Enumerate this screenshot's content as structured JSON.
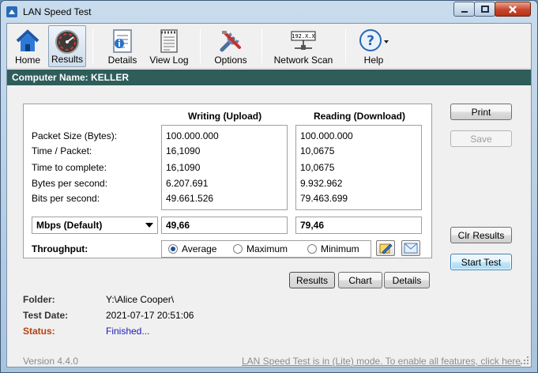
{
  "window": {
    "title": "LAN Speed Test"
  },
  "toolbar": {
    "items": [
      {
        "label": "Home",
        "icon": "home-icon"
      },
      {
        "label": "Results",
        "icon": "gauge-icon",
        "active": true
      },
      {
        "label": "Details",
        "icon": "details-icon"
      },
      {
        "label": "View Log",
        "icon": "log-icon"
      },
      {
        "label": "Options",
        "icon": "tools-icon"
      },
      {
        "label": "Network Scan",
        "icon": "network-icon",
        "badge": "192.X.X"
      },
      {
        "label": "Help",
        "icon": "help-icon"
      }
    ]
  },
  "header": {
    "computer_name": "Computer Name: KELLER"
  },
  "results": {
    "col_upload": "Writing (Upload)",
    "col_download": "Reading (Download)",
    "rows": [
      {
        "label": "Packet Size (Bytes):",
        "upload": "100.000.000",
        "download": "100.000.000"
      },
      {
        "label": "Time / Packet:",
        "upload": "16,1090",
        "download": "10,0675"
      },
      {
        "label": "Time to complete:",
        "upload": "16,1090",
        "download": "10,0675"
      },
      {
        "label": "Bytes per second:",
        "upload": "6.207.691",
        "download": "9.932.962"
      },
      {
        "label": "Bits per second:",
        "upload": "49.661.526",
        "download": "79.463.699"
      }
    ],
    "unit_select": "Mbps (Default)",
    "upload_mbps": "49,66",
    "download_mbps": "79,46",
    "throughput_label": "Throughput:",
    "throughput_options": [
      "Average",
      "Maximum",
      "Minimum"
    ],
    "throughput_selected": "Average"
  },
  "side_buttons": {
    "print": "Print",
    "save": "Save",
    "clr_results": "Clr Results",
    "start_test": "Start Test"
  },
  "view_tabs": [
    "Results",
    "Chart",
    "Details"
  ],
  "info": {
    "folder_label": "Folder:",
    "folder_value": "Y:\\Alice Cooper\\",
    "date_label": "Test Date:",
    "date_value": "2021-07-17 20:51:06",
    "status_label": "Status:",
    "status_value": "Finished..."
  },
  "footer": {
    "version": "Version 4.4.0",
    "lite_notice": "LAN Speed Test is in (Lite) mode.  To enable all features, click here"
  },
  "colors": {
    "header_bar": "#2e5d5a",
    "status_label": "#b8400d",
    "status_value": "#1a1ab8"
  }
}
